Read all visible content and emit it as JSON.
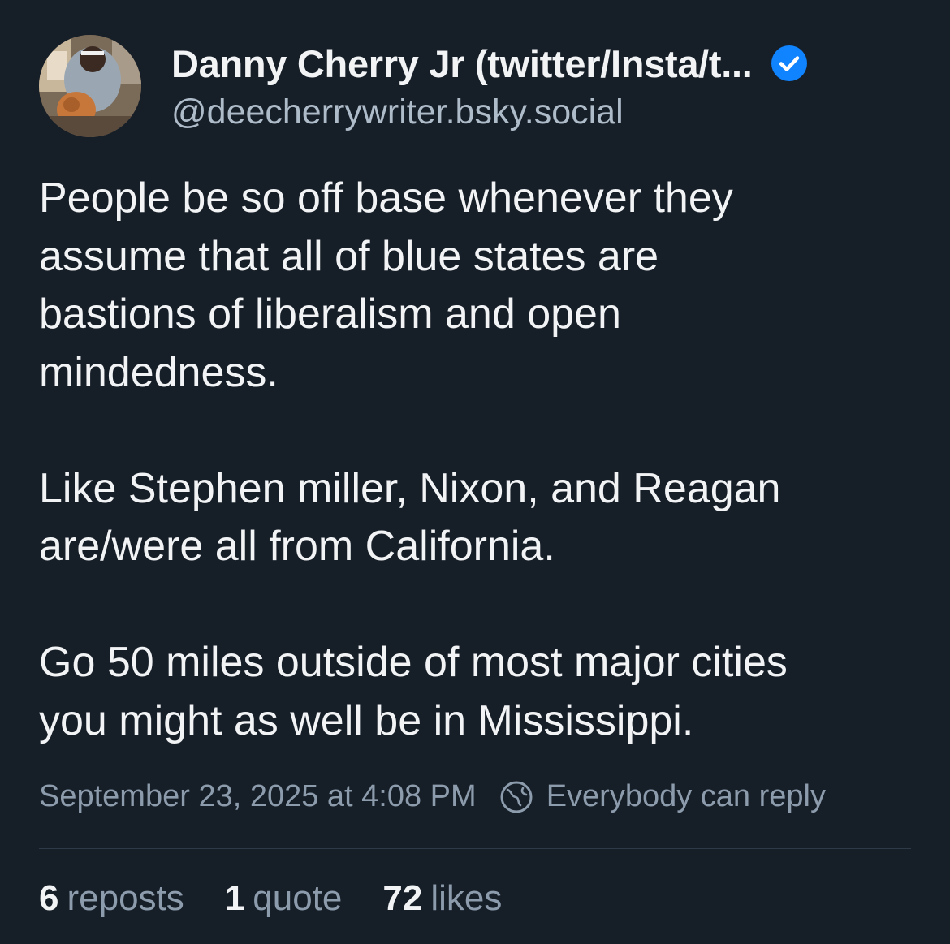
{
  "author": {
    "display_name": "Danny Cherry Jr (twitter/Insta/t...",
    "handle": "@deecherrywriter.bsky.social",
    "verified": true
  },
  "post": {
    "paragraphs": [
      "People be so off base whenever they\nassume that all of blue states are\nbastions of liberalism and open\nmindedness.",
      "Like Stephen miller, Nixon, and Reagan\nare/were all from California.",
      "Go 50 miles outside of most major cities\nyou might as well be in Mississippi."
    ],
    "timestamp": "September 23, 2025 at 4:08 PM",
    "reply_setting": "Everybody can reply"
  },
  "stats": {
    "reposts_count": "6",
    "reposts_label": "reposts",
    "quotes_count": "1",
    "quotes_label": "quote",
    "likes_count": "72",
    "likes_label": "likes"
  },
  "colors": {
    "background": "#161e27",
    "verified_blue": "#1083fe",
    "muted_text": "#8d9cad"
  }
}
